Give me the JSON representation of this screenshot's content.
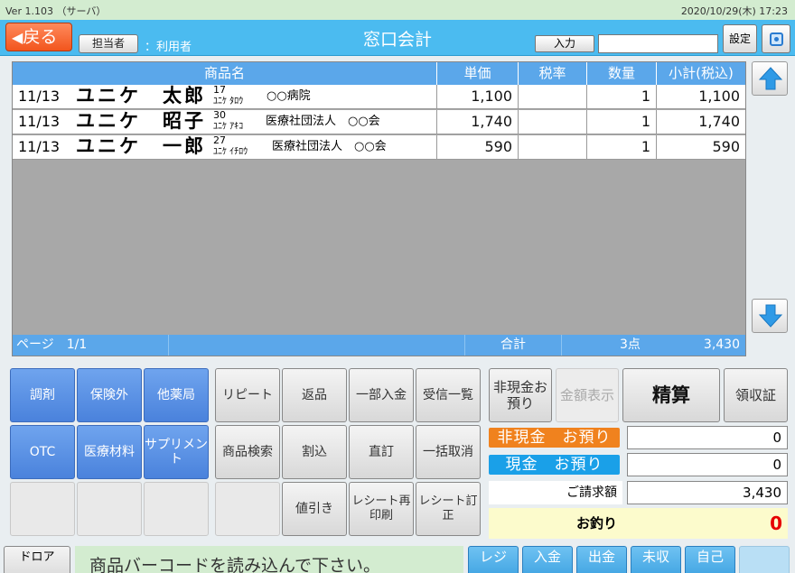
{
  "status": {
    "version": "Ver 1.103 （サーバ）",
    "datetime": "2020/10/29(木) 17:23"
  },
  "header": {
    "back_label": "戻る",
    "staff_btn": "担当者",
    "staff_name": "：利用者",
    "title": "窓口会計",
    "input_btn": "入力",
    "input_value": "",
    "settings_btn": "設定"
  },
  "table": {
    "columns": [
      "商品名",
      "単価",
      "税率",
      "数量",
      "小計(税込)"
    ],
    "rows": [
      {
        "date": "11/13",
        "name": "ユニケ　太郎",
        "age": "17",
        "kana": "ﾕﾆｹ ﾀﾛｳ",
        "inst": "○○病院",
        "price": "1,100",
        "tax": "",
        "qty": "1",
        "subtotal": "1,100"
      },
      {
        "date": "11/13",
        "name": "ユニケ　昭子",
        "age": "30",
        "kana": "ﾕﾆｹ ｱｷｺ",
        "inst": "医療社団法人　○○会",
        "price": "1,740",
        "tax": "",
        "qty": "1",
        "subtotal": "1,740"
      },
      {
        "date": "11/13",
        "name": "ユニケ　一郎",
        "age": "27",
        "kana": "ﾕﾆｹ ｲﾁﾛｳ",
        "inst": "医療社団法人　○○会",
        "price": "590",
        "tax": "",
        "qty": "1",
        "subtotal": "590"
      }
    ],
    "footer": {
      "page": "ページ　1/1",
      "total_label": "合計",
      "count": "3点",
      "total": "3,430"
    }
  },
  "keys": {
    "row1": [
      "調剤",
      "保険外",
      "他薬局"
    ],
    "row2": [
      "OTC",
      "医療材料",
      "サプリメント"
    ],
    "gray1": [
      "リピート",
      "返品",
      "一部入金",
      "受信一覧"
    ],
    "gray2": [
      "商品検索",
      "割込",
      "直訂",
      "一括取消"
    ],
    "gray3": [
      "値引き",
      "レシート再印刷",
      "レシート訂正"
    ]
  },
  "payment": {
    "noncash_deposit_btn": "非現金お預り",
    "amount_display_btn": "金額表示",
    "settle_btn": "精算",
    "receipt_btn": "領収証",
    "noncash_label": "非現金　お預り",
    "noncash_value": "0",
    "cash_label": "現金　お預り",
    "cash_value": "0",
    "bill_label": "ご請求額",
    "bill_value": "3,430",
    "change_label": "お釣り",
    "change_value": "0",
    "noncash_color": "#f0821e",
    "cash_color": "#1aa0e8",
    "change_color": "#e60000"
  },
  "bottom": {
    "drawer_btn": "ドロア",
    "message": "商品バーコードを読み込んで下さい。",
    "fbtns": [
      "レジ",
      "入金",
      "出金",
      "未収",
      "自己"
    ]
  }
}
